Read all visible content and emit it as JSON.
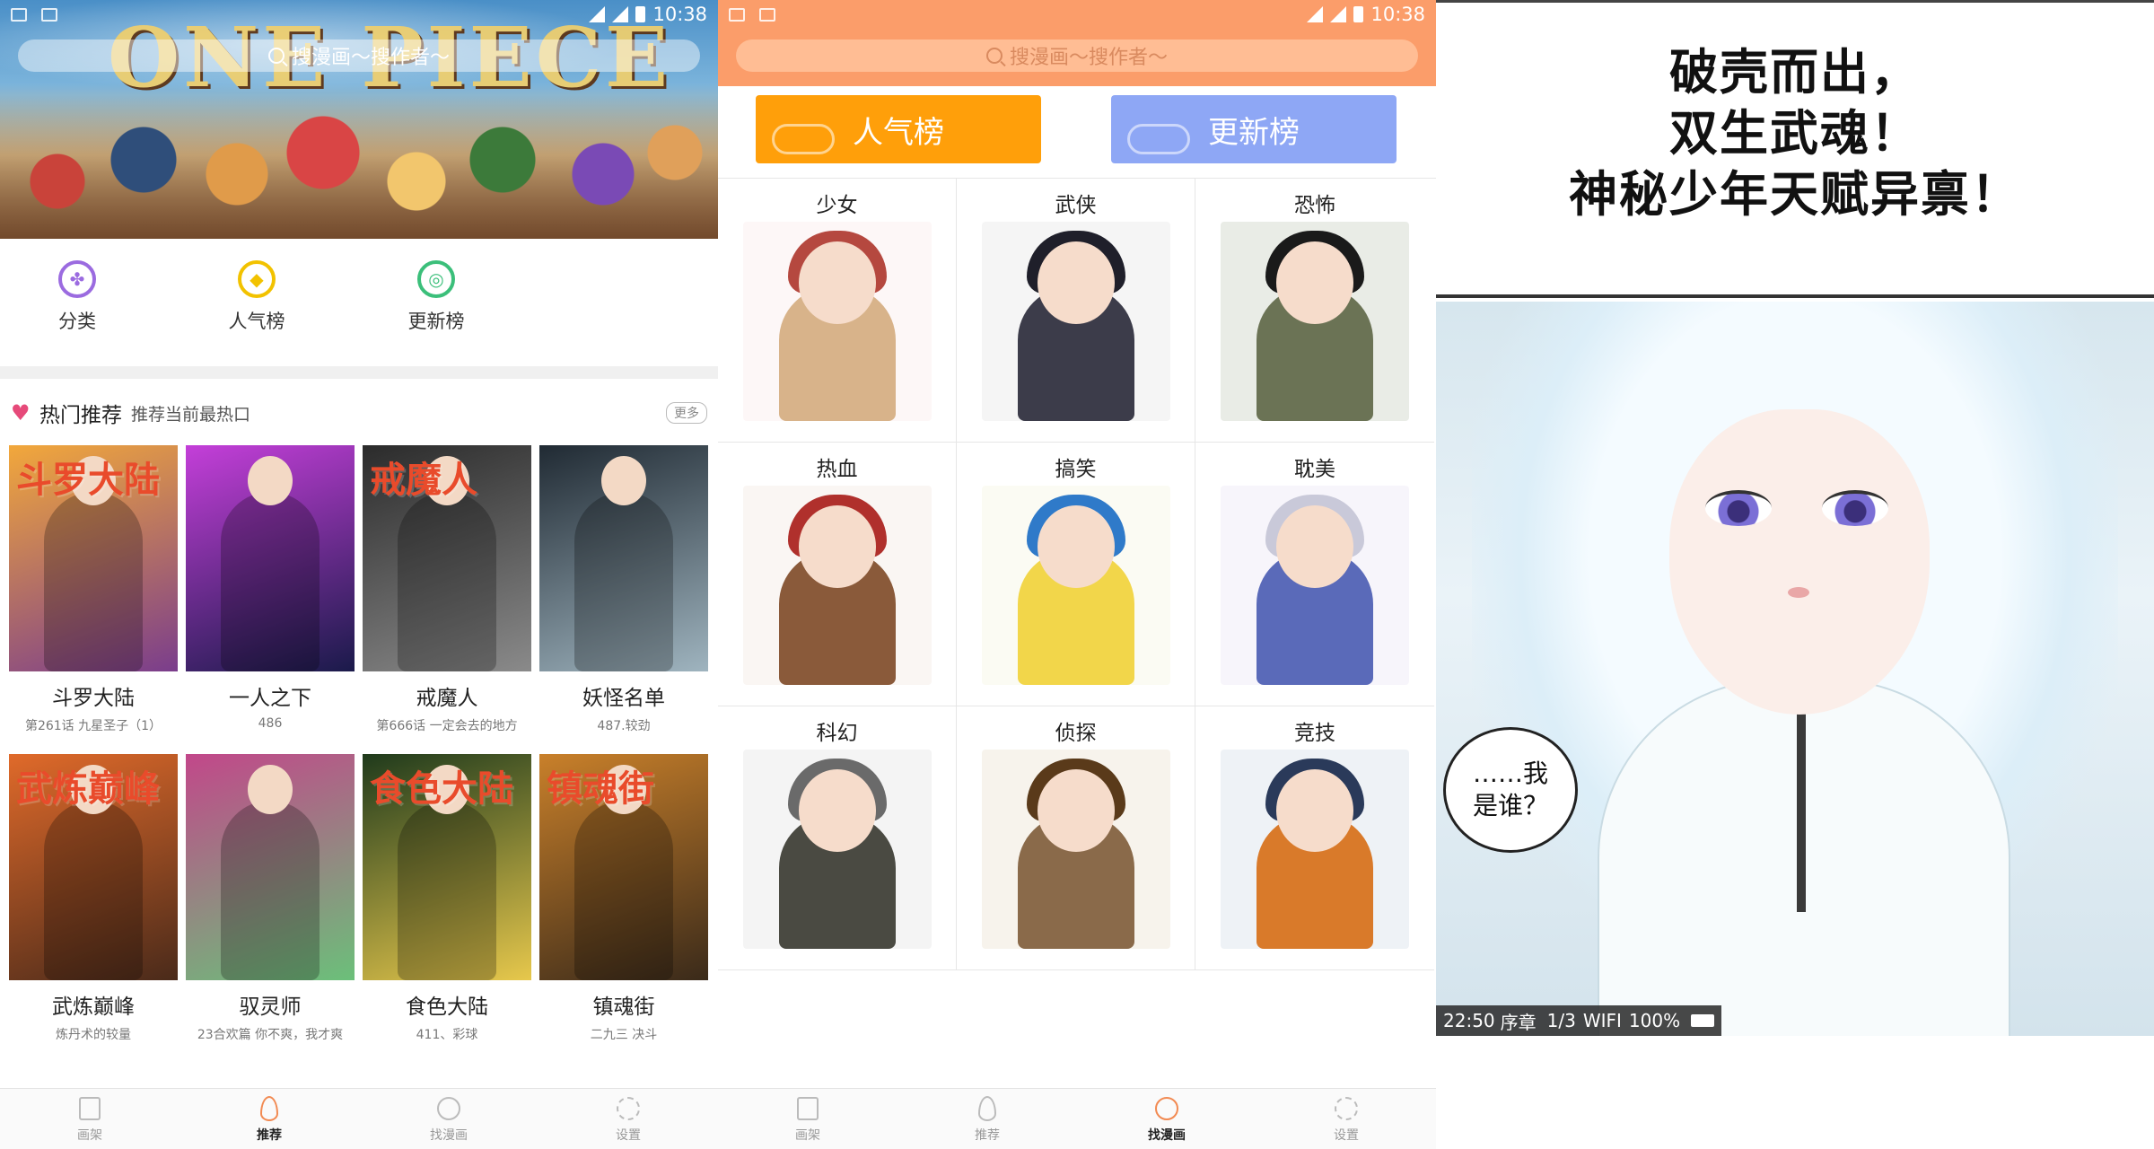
{
  "statusbar": {
    "time": "10:38"
  },
  "search": {
    "placeholder": "搜漫画～搜作者～"
  },
  "home": {
    "banner_logo": "ONE PIECE",
    "quicknav": [
      {
        "label": "分类",
        "icon": "category-icon",
        "color": "#9b6be0"
      },
      {
        "label": "人气榜",
        "icon": "flame-icon",
        "color": "#f2c200"
      },
      {
        "label": "更新榜",
        "icon": "update-icon",
        "color": "#3bbf7a"
      }
    ],
    "hot": {
      "title": "热门推荐",
      "subtitle": "推荐当前最热口",
      "more": "更多"
    },
    "comics": [
      {
        "name": "斗罗大陆",
        "sub": "第261话 九星圣子（1）",
        "cover_title": "斗罗大陆",
        "c1": "#f2a83b",
        "c2": "#7a3d8c"
      },
      {
        "name": "一人之下",
        "sub": "486",
        "cover_title": "",
        "c1": "#c43fd9",
        "c2": "#1a1a4a"
      },
      {
        "name": "戒魔人",
        "sub": "第666话 一定会去的地方",
        "cover_title": "戒魔人",
        "c1": "#2b2b2b",
        "c2": "#8a8a8a"
      },
      {
        "name": "妖怪名单",
        "sub": "487.较劲",
        "cover_title": "",
        "c1": "#202a33",
        "c2": "#9fb4bf"
      },
      {
        "name": "武炼巅峰",
        "sub": "炼丹术的较量",
        "cover_title": "武炼巅峰",
        "c1": "#e06a2a",
        "c2": "#4a2a1a"
      },
      {
        "name": "驭灵师",
        "sub": "23合欢篇 你不爽，我才爽",
        "cover_title": "",
        "c1": "#c2478a",
        "c2": "#6bc07a"
      },
      {
        "name": "食色大陆",
        "sub": "411、彩球",
        "cover_title": "食色大陆",
        "c1": "#1f3a1c",
        "c2": "#e7c84c"
      },
      {
        "name": "镇魂街",
        "sub": "二九三 决斗",
        "cover_title": "镇魂街",
        "c1": "#c9802a",
        "c2": "#3a2a1a"
      }
    ]
  },
  "tabs": [
    {
      "label": "画架",
      "icon": "bookshelf-icon"
    },
    {
      "label": "推荐",
      "icon": "flame-icon"
    },
    {
      "label": "找漫画",
      "icon": "search-icon"
    },
    {
      "label": "设置",
      "icon": "gear-icon"
    }
  ],
  "find": {
    "rank_hot": "人气榜",
    "rank_new": "更新榜",
    "categories": [
      {
        "label": "少女",
        "bg": "#fdf7f7",
        "hair": "#b5483f",
        "body": "#d8b38a"
      },
      {
        "label": "武侠",
        "bg": "#f5f5f5",
        "hair": "#1f1f2a",
        "body": "#3c3c4a"
      },
      {
        "label": "恐怖",
        "bg": "#e9ece6",
        "hair": "#1a1a1a",
        "body": "#6b7355"
      },
      {
        "label": "热血",
        "bg": "#faf6f3",
        "hair": "#b0302c",
        "body": "#8a5a3a"
      },
      {
        "label": "搞笑",
        "bg": "#fbfbf3",
        "hair": "#2f7ac9",
        "body": "#f2d64a"
      },
      {
        "label": "耽美",
        "bg": "#f7f5fb",
        "hair": "#c9c9d9",
        "body": "#5a6ab9"
      },
      {
        "label": "科幻",
        "bg": "#f4f4f4",
        "hair": "#6a6a6a",
        "body": "#4a4a42"
      },
      {
        "label": "侦探",
        "bg": "#f7f3ec",
        "hair": "#5a3a1a",
        "body": "#8a6a4a"
      },
      {
        "label": "竞技",
        "bg": "#eef2f6",
        "hair": "#2a3a5a",
        "body": "#d97a2a"
      }
    ]
  },
  "reader": {
    "caption_lines": [
      "破壳而出，",
      "双生武魂！",
      "神秘少年天赋异禀！"
    ],
    "bubble": "……我\n是谁？",
    "status": {
      "time": "22:50",
      "chapter": "序章",
      "page": "1/3",
      "network": "WIFI",
      "battery": "100%"
    }
  }
}
